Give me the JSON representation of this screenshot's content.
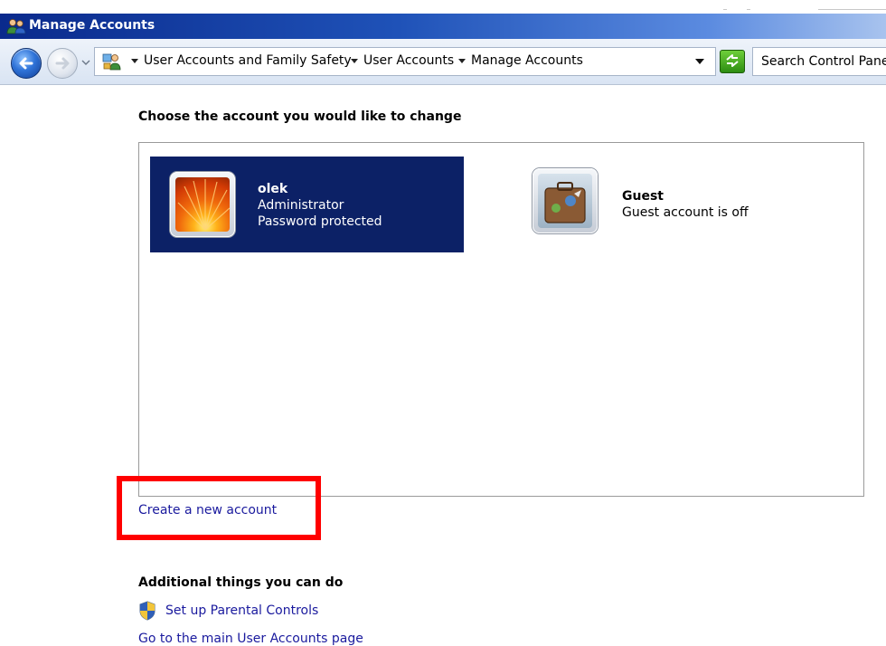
{
  "window": {
    "title": "Manage Accounts"
  },
  "address_bar": {
    "breadcrumbs": [
      "User Accounts and Family Safety",
      "User Accounts",
      "Manage Accounts"
    ],
    "search_placeholder": "Search Control Panel"
  },
  "main": {
    "heading": "Choose the account you would like to change",
    "accounts": [
      {
        "name": "olek",
        "lines": [
          "Administrator",
          "Password protected"
        ],
        "selected": true,
        "picture": "orange-flower-icon"
      },
      {
        "name": "Guest",
        "lines": [
          "Guest account is off"
        ],
        "selected": false,
        "picture": "suitcase-icon"
      }
    ],
    "create_link": "Create a new account",
    "additional_heading": "Additional things you can do",
    "additional_links": [
      "Set up Parental Controls",
      "Go to the main User Accounts page"
    ]
  },
  "colors": {
    "selected_account_bg": "#0c2166",
    "link": "#1a1a9e",
    "highlight": "#ff0000"
  }
}
